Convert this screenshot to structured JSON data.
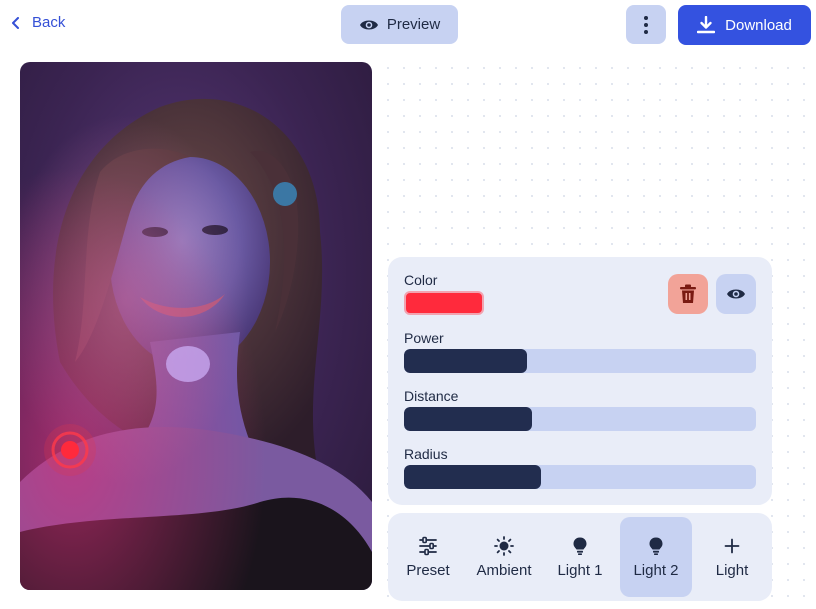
{
  "header": {
    "back_label": "Back",
    "preview_label": "Preview",
    "download_label": "Download"
  },
  "light_panel": {
    "color_label": "Color",
    "color_value": "#ff2a3c",
    "power_label": "Power",
    "power_level": 0.35,
    "distance_label": "Distance",
    "distance_level": 0.365,
    "radius_label": "Radius",
    "radius_level": 0.39
  },
  "tabs": [
    {
      "label": "Preset",
      "icon": "sliders-icon"
    },
    {
      "label": "Ambient",
      "icon": "sun-icon"
    },
    {
      "label": "Light 1",
      "icon": "bulb-icon"
    },
    {
      "label": "Light 2",
      "icon": "bulb-icon",
      "active": true
    },
    {
      "label": "Light",
      "icon": "plus-icon"
    }
  ],
  "colors": {
    "accent": "#3452e0",
    "button_soft": "#c7d2f2",
    "panel_bg": "#e9edf8",
    "slider_fill": "#222d4f",
    "delete_bg": "#f2a398"
  }
}
